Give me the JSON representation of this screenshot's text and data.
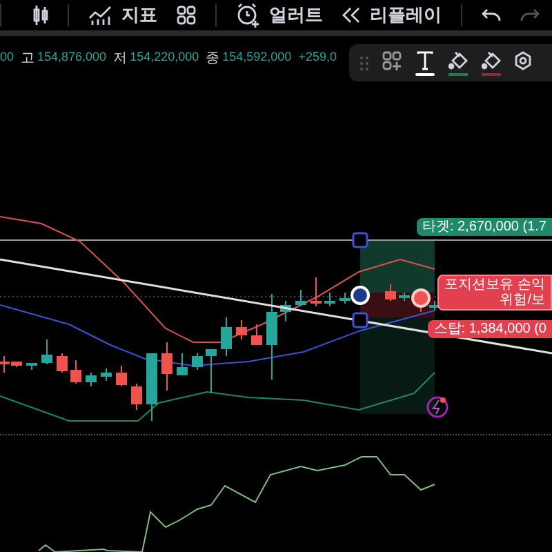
{
  "toolbar": {
    "items": [
      {
        "kind": "candles"
      },
      {
        "kind": "indicators",
        "label": "지표"
      },
      {
        "kind": "templates"
      },
      {
        "kind": "alert",
        "label": "얼러트"
      },
      {
        "kind": "replay",
        "label": "리플레이"
      },
      {
        "kind": "undo",
        "disabled": false
      },
      {
        "kind": "redo",
        "disabled": true
      }
    ]
  },
  "ohlc": {
    "partial": "00",
    "high_label": "고",
    "high": "154,876,000",
    "low_label": "저",
    "low": "154,220,000",
    "close_label": "종",
    "close": "154,592,000",
    "change": "+259,0"
  },
  "drawing_toolbar": {
    "tools": [
      {
        "kind": "add",
        "selected": false
      },
      {
        "kind": "text",
        "selected": true
      },
      {
        "kind": "fill",
        "color": "#1f7a57"
      },
      {
        "kind": "fill",
        "color": "#8c2b36"
      },
      {
        "kind": "settings"
      }
    ]
  },
  "position": {
    "target": "타겟: 2,670,000 (1.7",
    "info": [
      "포지션보유 손익",
      "위험/보"
    ],
    "stop": "스탑: 1,384,000 (0"
  }
}
